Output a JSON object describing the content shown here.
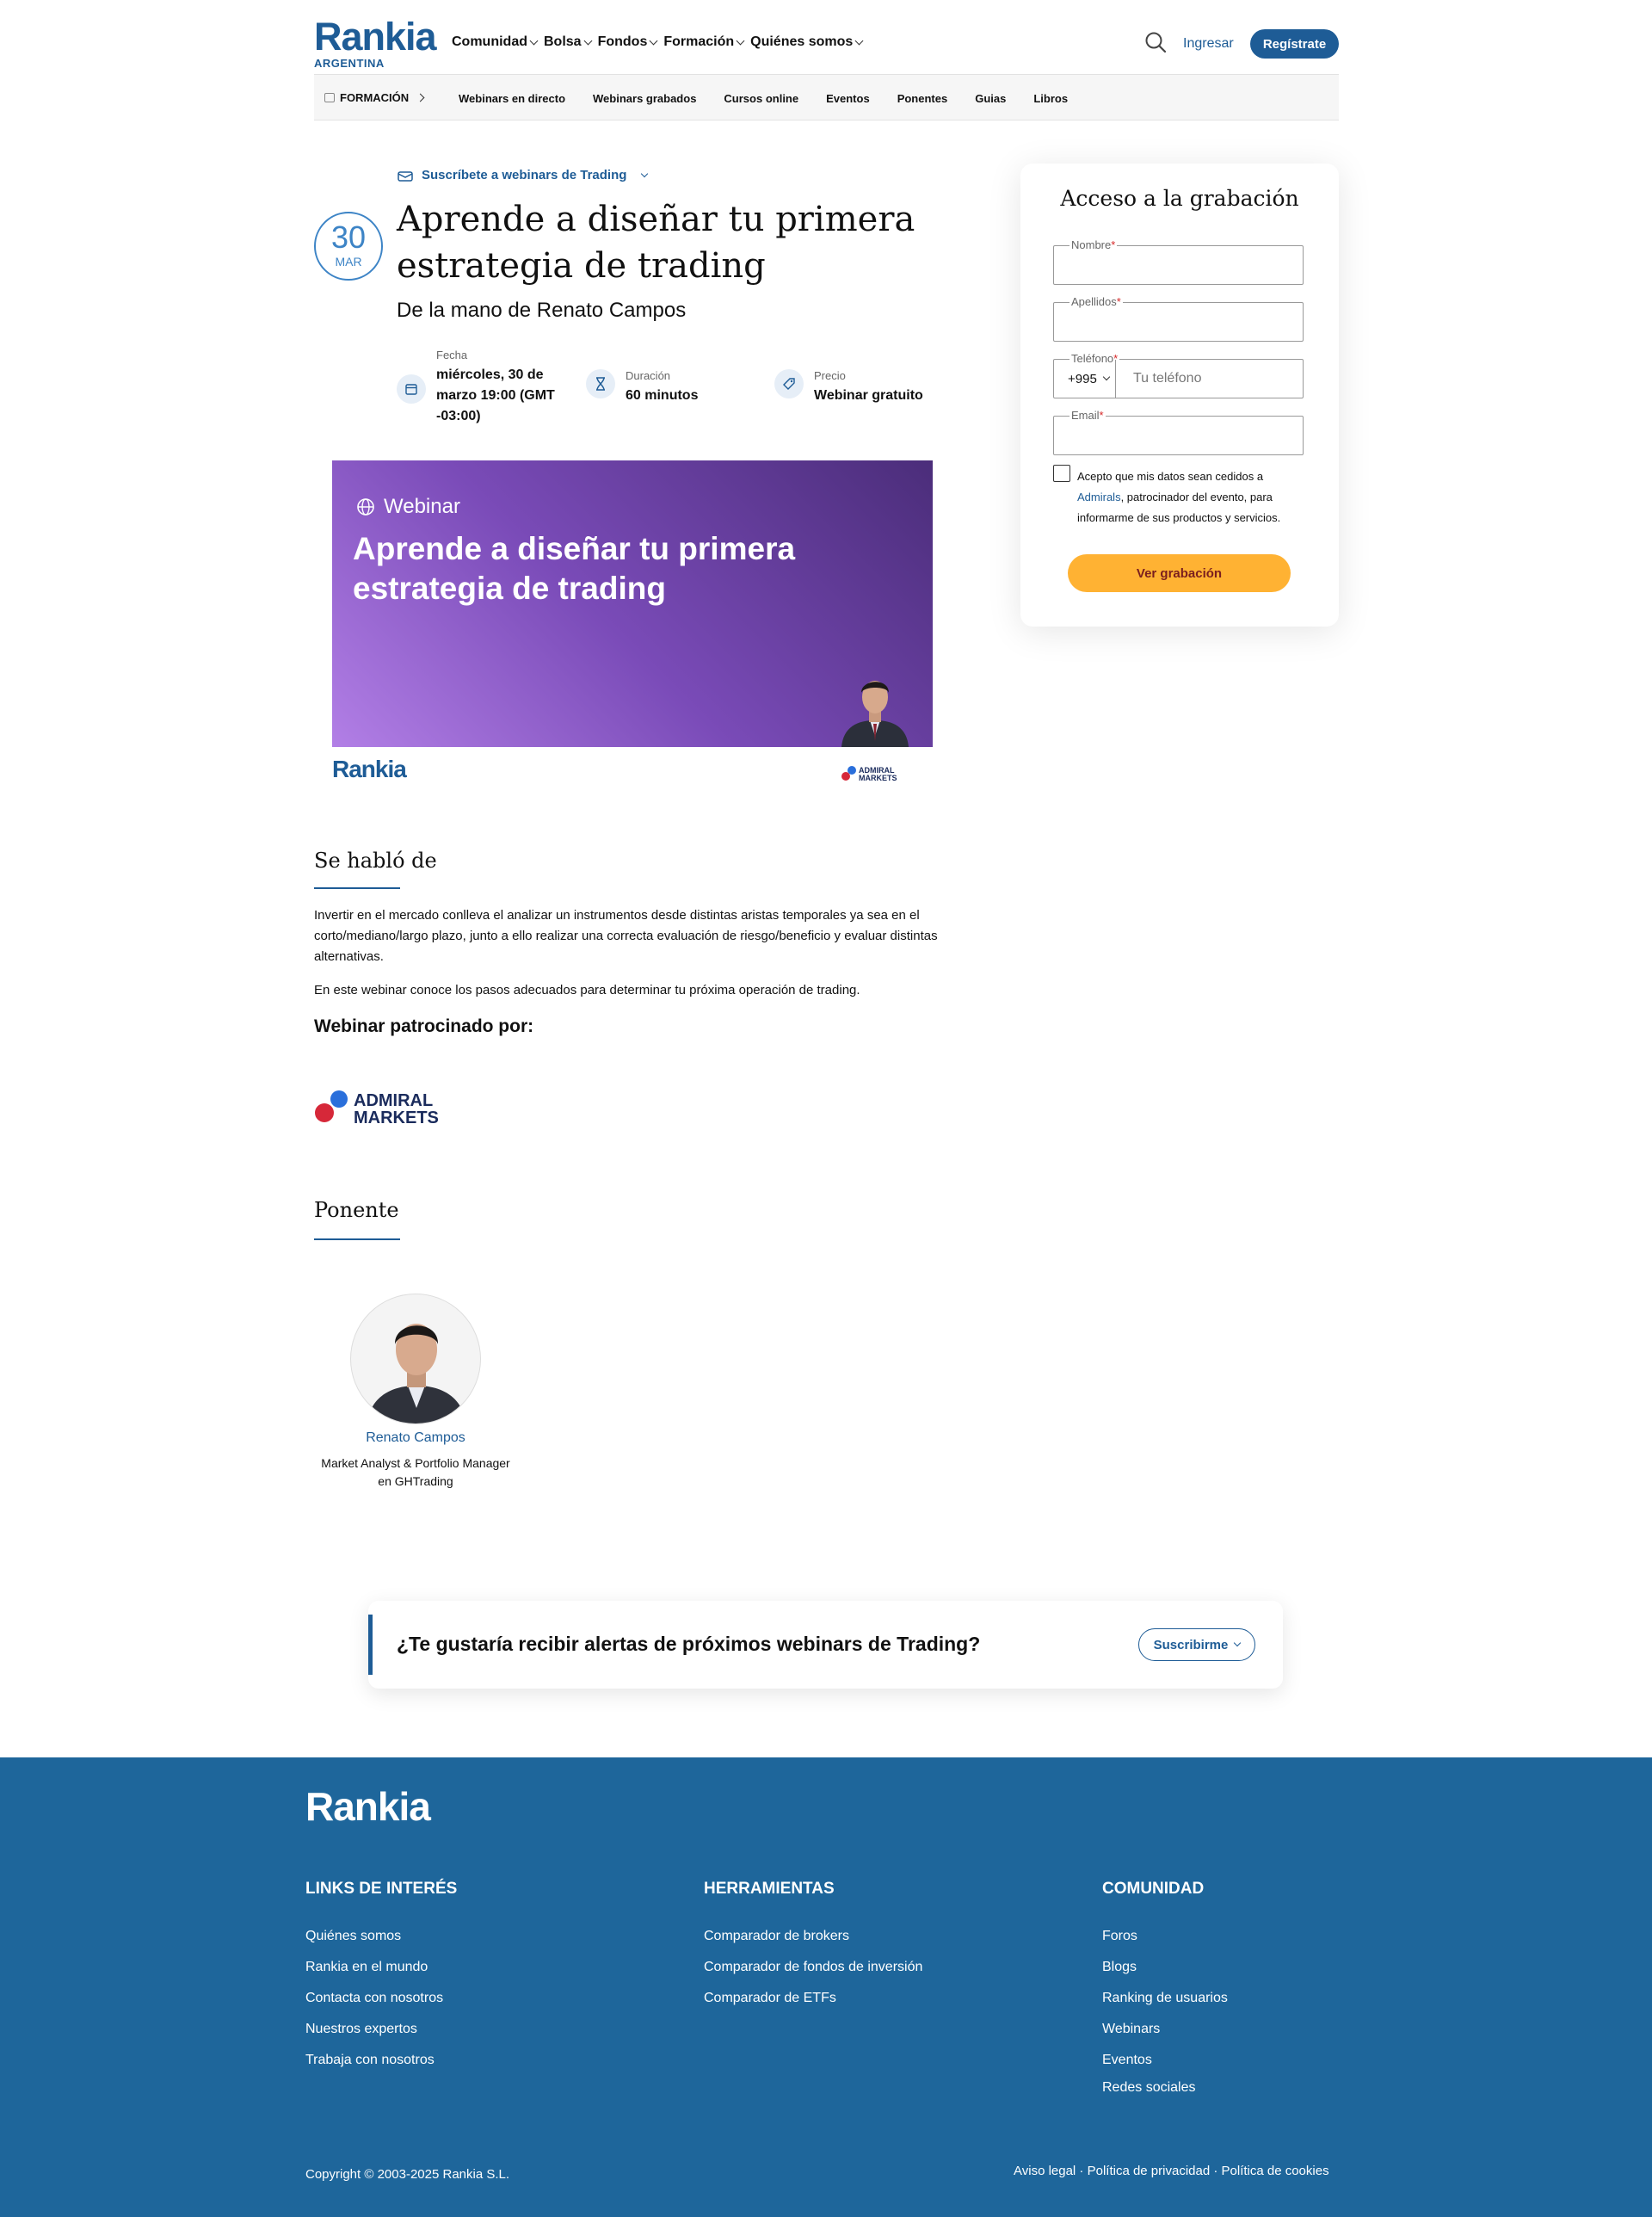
{
  "header": {
    "logo_text": "Rankia",
    "logo_sub": "ARGENTINA",
    "nav": [
      "Comunidad",
      "Bolsa",
      "Fondos",
      "Formación",
      "Quiénes somos"
    ],
    "login": "Ingresar",
    "register": "Regístrate"
  },
  "subnav": {
    "section": "FORMACIÓN",
    "links": [
      "Webinars en directo",
      "Webinars grabados",
      "Cursos online",
      "Eventos",
      "Ponentes",
      "Guias",
      "Libros"
    ]
  },
  "event": {
    "subscribe_link": "Suscríbete a webinars de Trading",
    "day": "30",
    "month": "MAR",
    "title": "Aprende a diseñar tu primera estrategia de trading",
    "subtitle": "De la mano de Renato Campos",
    "meta": {
      "date_label": "Fecha",
      "date_value": "miércoles, 30 de marzo 19:00 (GMT -03:00)",
      "duration_label": "Duración",
      "duration_value": "60 minutos",
      "price_label": "Precio",
      "price_value": "Webinar gratuito"
    },
    "banner": {
      "tag": "Webinar",
      "title": "Aprende a diseñar tu primera estrategia de trading",
      "brand": "Rankia",
      "sponsor": "ADMIRAL MARKETS"
    }
  },
  "about": {
    "heading": "Se habló de",
    "p1": "Invertir en el mercado conlleva el analizar un instrumentos desde distintas aristas temporales ya sea en el corto/mediano/largo plazo, junto a ello realizar una correcta evaluación de riesgo/beneficio y evaluar distintas alternativas.",
    "p2": "En este webinar conoce los pasos adecuados para determinar tu próxima operación de trading.",
    "sponsored_by": "Webinar patrocinado por:",
    "sponsor_logo": "ADMIRAL MARKETS"
  },
  "speaker": {
    "heading": "Ponente",
    "name": "Renato Campos",
    "role": "Market Analyst & Portfolio Manager en GHTrading"
  },
  "form": {
    "title": "Acceso a la grabación",
    "name_label": "Nombre",
    "surname_label": "Apellidos",
    "phone_label": "Teléfono",
    "phone_code": "+995",
    "phone_placeholder": "Tu teléfono",
    "email_label": "Email",
    "required_mark": "*",
    "consent_pre": "Acepto que mis datos sean cedidos a ",
    "consent_link": "Admirals",
    "consent_post": ", patrocinador del evento, para informarme de sus productos y servicios.",
    "submit": "Ver grabación"
  },
  "alerts": {
    "question": "¿Te gustaría recibir alertas de próximos webinars de Trading?",
    "button": "Suscribirme"
  },
  "footer": {
    "logo": "Rankia",
    "col1": {
      "heading": "LINKS DE INTERÉS",
      "items": [
        "Quiénes somos",
        "Rankia en el mundo",
        "Contacta con nosotros",
        "Nuestros expertos",
        "Trabaja con nosotros"
      ]
    },
    "col2": {
      "heading": "HERRAMIENTAS",
      "items": [
        "Comparador de brokers",
        "Comparador de fondos de inversión",
        "Comparador de ETFs"
      ]
    },
    "col3": {
      "heading": "COMUNIDAD",
      "items": [
        "Foros",
        "Blogs",
        "Ranking de usuarios",
        "Webinars",
        "Eventos",
        "Redes sociales"
      ]
    },
    "copyright": "Copyright © 2003-2025 Rankia S.L.",
    "legal": "Aviso legal · Política de privacidad · Política de cookies"
  },
  "colors": {
    "brand_blue": "#1e5c96",
    "footer_blue": "#1e669b",
    "accent_orange": "#ffb233",
    "logo_red": "#d62828"
  }
}
